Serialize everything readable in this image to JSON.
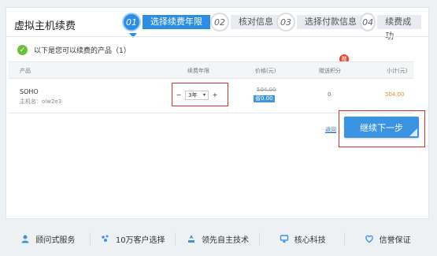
{
  "page_title": "虚拟主机续费",
  "steps": [
    {
      "num": "01",
      "label": "选择续费年限",
      "active": true
    },
    {
      "num": "02",
      "label": "核对信息",
      "active": false
    },
    {
      "num": "03",
      "label": "选择付款信息",
      "active": false
    },
    {
      "num": "04",
      "label": "续费成功",
      "active": false
    }
  ],
  "notice": "以下是您可以续费的产品（1）",
  "table": {
    "headers": [
      "产品",
      "续费年限",
      "价格(元)",
      "赠送积分",
      "小计(元)"
    ],
    "badge": "赠",
    "row": {
      "product": "SOHO",
      "host": "主机名：olw2e3",
      "years": "3年",
      "price_old": "504.00",
      "save": "省0.00",
      "points": "0",
      "subtotal": "504.00"
    }
  },
  "back_link": "返回",
  "next_button": "继续下一步",
  "features": [
    {
      "icon": "person-icon",
      "label": "顾问式服务"
    },
    {
      "icon": "users-icon",
      "label": "10万客户选择"
    },
    {
      "icon": "tech-icon",
      "label": "领先自主技术"
    },
    {
      "icon": "core-icon",
      "label": "核心科技"
    },
    {
      "icon": "heart-shield-icon",
      "label": "信誉保证"
    }
  ]
}
